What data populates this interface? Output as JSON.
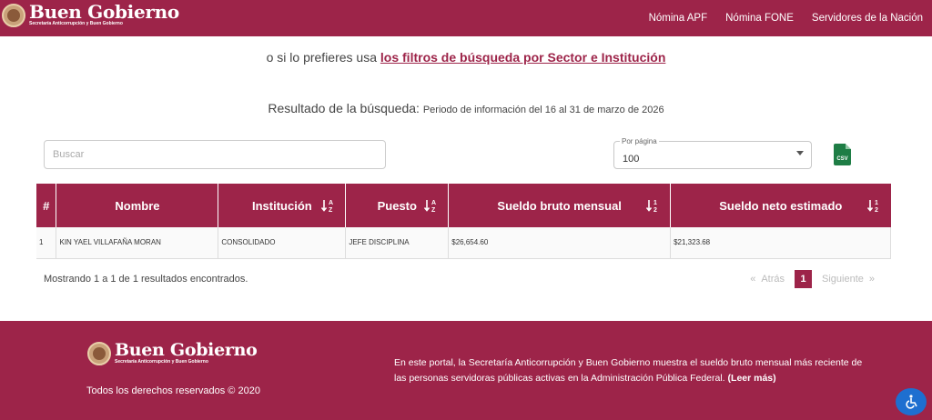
{
  "header": {
    "logo_title": "Buen Gobierno",
    "logo_subtitle": "Secretaría Anticorrupción y Buen Gobierno",
    "nav": [
      "Nómina APF",
      "Nómina FONE",
      "Servidores de la Nación"
    ]
  },
  "filters": {
    "prefix": "o si lo prefieres usa ",
    "link": "los filtros de búsqueda por Sector e Institución"
  },
  "result": {
    "title": "Resultado de la búsqueda: ",
    "period": "Periodo de información del 16 al 31 de marzo de 2026"
  },
  "search": {
    "placeholder": "Buscar"
  },
  "per_page": {
    "label": "Por página",
    "value": "100"
  },
  "csv_label": "CSV",
  "table": {
    "headers": [
      "#",
      "Nombre",
      "Institución",
      "Puesto",
      "Sueldo bruto mensual",
      "Sueldo neto estimado"
    ],
    "rows": [
      [
        "1",
        "KIN YAEL VILLAFAÑA MORAN",
        "CONSOLIDADO",
        "JEFE DISCIPLINA",
        "$26,654.60",
        "$21,323.68"
      ]
    ]
  },
  "summary": "Mostrando 1 a 1 de 1 resultados encontrados.",
  "pagination": {
    "prev": "Atrás",
    "current": "1",
    "next": "Siguiente",
    "first_marker": "«",
    "last_marker": "»"
  },
  "footer": {
    "logo_title": "Buen Gobierno",
    "logo_subtitle": "Secretaría Anticorrupción y Buen Gobierno",
    "rights": "Todos los derechos reservados © 2020",
    "about": "En este portal, la Secretaría Anticorrupción y Buen Gobierno muestra el sueldo bruto mensual más reciente de las personas servidoras públicas activas en la Administración Pública Federal.",
    "more": "(Leer más)"
  },
  "colors": {
    "brand": "#9d2449",
    "csv_green": "#1e7d45",
    "a11y_blue": "#1e6fd0"
  }
}
